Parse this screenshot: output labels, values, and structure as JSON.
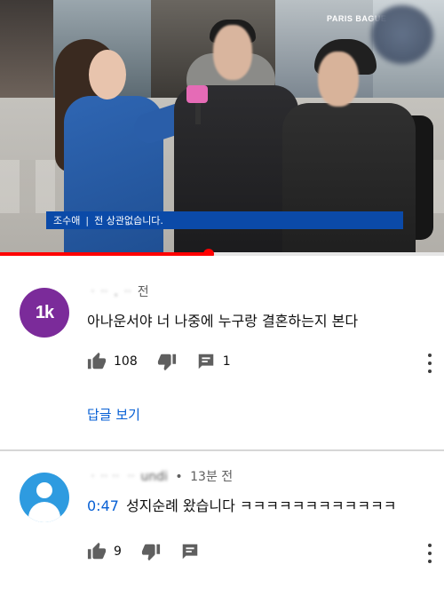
{
  "video": {
    "caption_name": "조수애",
    "caption_separator": "|",
    "caption_text": "전 상관없습니다.",
    "shop_sign": "PARIS BAGUE",
    "progress": 0.47,
    "colors": {
      "caption_bg": "#0b4aa8",
      "progress": "#ff0000"
    }
  },
  "comments": [
    {
      "avatar_initials": "1k",
      "avatar_color": "#7b2b9a",
      "author": "ᆞᆢ ․ ᆢ",
      "age": "전",
      "text": "아나운서야 너 나중에 누구랑 결혼하는지 본다",
      "likes": "108",
      "replies_label": "답글 보기",
      "icons": [
        "thumb-up-icon",
        "thumb-down-icon",
        "reply-icon",
        "more-vert-icon"
      ],
      "reply_count": "1"
    },
    {
      "avatar_color": "#2e9be0",
      "author": "ᆞᆢᆢ ᆢ undi",
      "age": "13분 전",
      "timestamp": "0:47",
      "text": "성지순례 왔습니다 ㅋㅋㅋㅋㅋㅋㅋㅋㅋㅋㅋㅋ",
      "likes": "9",
      "icons": [
        "thumb-up-icon",
        "thumb-down-icon",
        "reply-icon",
        "more-vert-icon"
      ]
    }
  ],
  "link_color": "#065fd4"
}
